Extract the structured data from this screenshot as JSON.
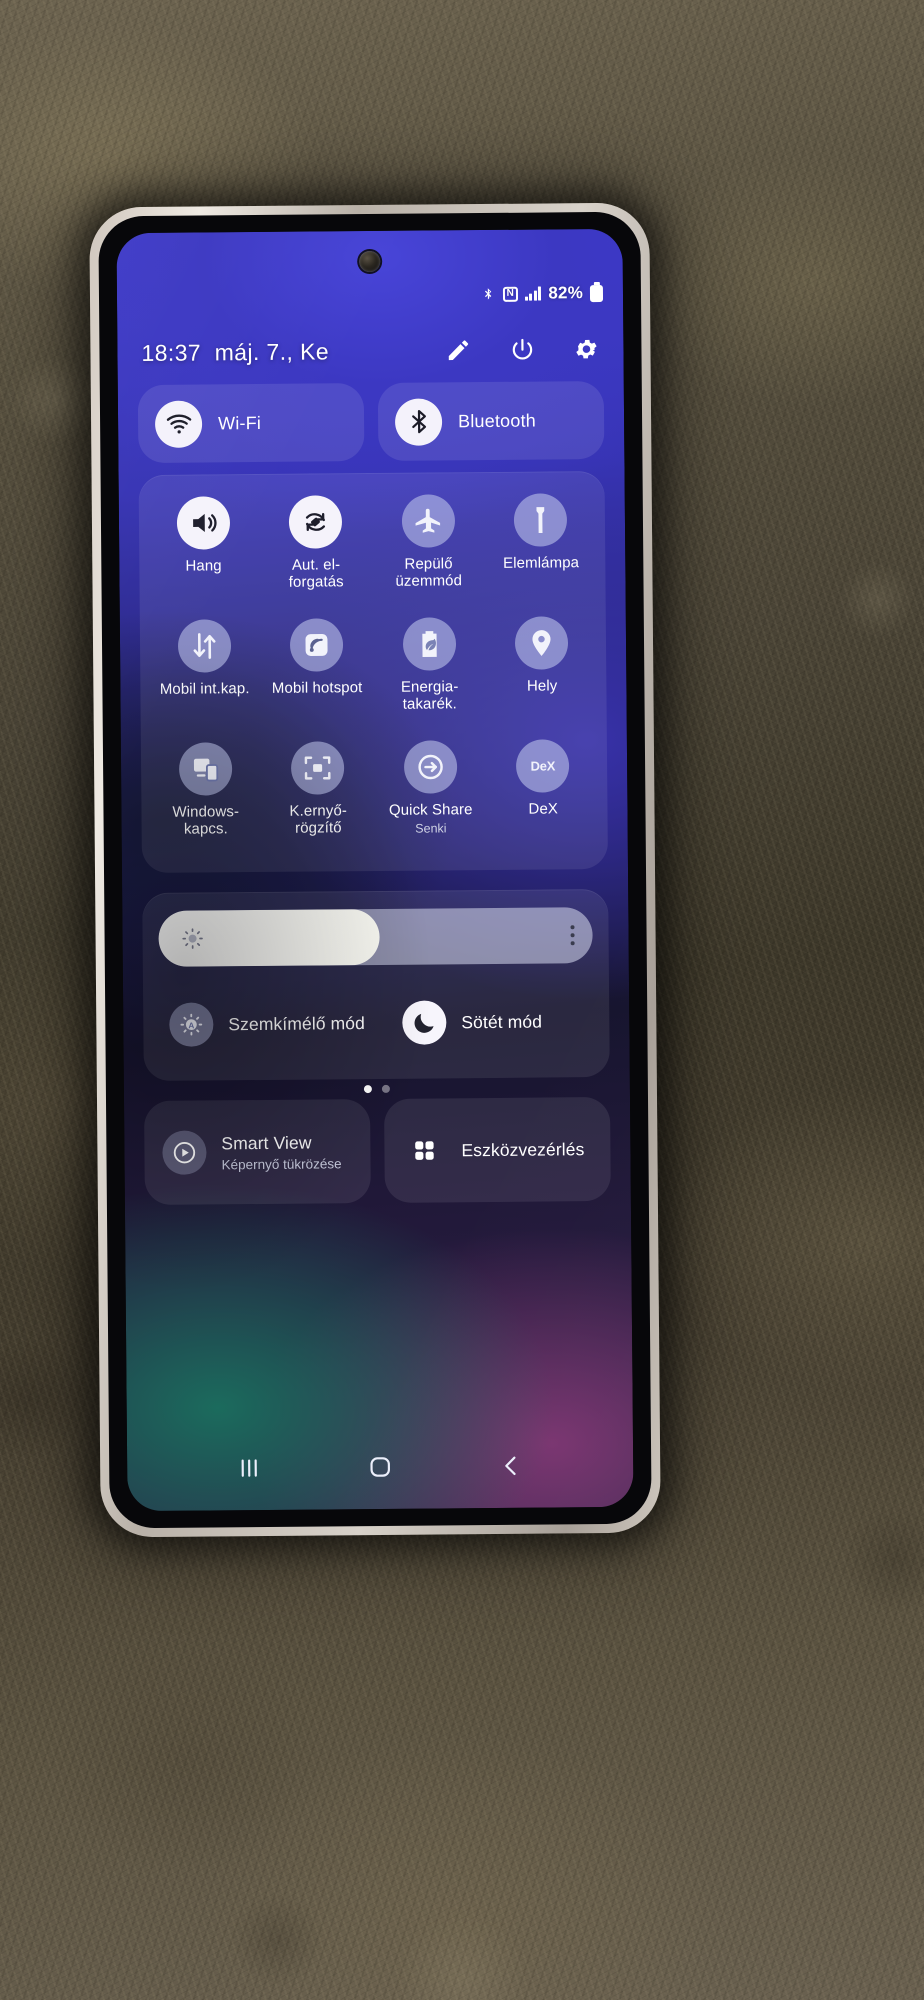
{
  "statusbar": {
    "bluetooth_icon": "bluetooth-icon",
    "nfc_icon": "nfc-icon",
    "nfc_glyph": "N",
    "signal_icon": "signal-bars-icon",
    "battery_percent": "82%",
    "battery_icon": "battery-icon"
  },
  "header": {
    "time": "18:37",
    "date": "máj. 7., Ke",
    "actions": [
      {
        "name": "edit-pencil-icon",
        "label": "Szerkesztés"
      },
      {
        "name": "power-icon",
        "label": "Be-/kikapcsolás"
      },
      {
        "name": "settings-gear-icon",
        "label": "Beállítások"
      }
    ]
  },
  "pills": [
    {
      "icon": "wifi-icon",
      "label": "Wi-Fi",
      "state": "on"
    },
    {
      "icon": "bluetooth-icon",
      "label": "Bluetooth",
      "state": "on"
    }
  ],
  "tiles": [
    {
      "icon": "sound-icon",
      "label": "Hang",
      "sub": "",
      "state": "on"
    },
    {
      "icon": "auto-rotate-icon",
      "label": "Aut. el-forgatás",
      "sub": "",
      "state": "on"
    },
    {
      "icon": "airplane-icon",
      "label": "Repülő üzemmód",
      "sub": "",
      "state": "off"
    },
    {
      "icon": "flashlight-icon",
      "label": "Elemlámpa",
      "sub": "",
      "state": "off"
    },
    {
      "icon": "mobile-data-icon",
      "label": "Mobil int.kap.",
      "sub": "",
      "state": "off"
    },
    {
      "icon": "hotspot-icon",
      "label": "Mobil hotspot",
      "sub": "",
      "state": "off"
    },
    {
      "icon": "power-saving-icon",
      "label": "Energia-takarék.",
      "sub": "",
      "state": "off"
    },
    {
      "icon": "location-pin-icon",
      "label": "Hely",
      "sub": "",
      "state": "off"
    },
    {
      "icon": "windows-link-icon",
      "label": "Windows-kapcs.",
      "sub": "",
      "state": "off"
    },
    {
      "icon": "screen-record-icon",
      "label": "K.ernyő-rögzítő",
      "sub": "",
      "state": "off"
    },
    {
      "icon": "quick-share-icon",
      "label": "Quick Share",
      "sub": "Senki",
      "state": "off"
    },
    {
      "icon": "dex-icon",
      "label": "DeX",
      "sub": "",
      "state": "off"
    }
  ],
  "pager": {
    "total": 2,
    "current": 1
  },
  "brightness": {
    "icon": "brightness-sun-icon",
    "value_percent": 51,
    "more_icon": "more-options-icon"
  },
  "modes": [
    {
      "icon": "eye-comfort-icon",
      "label": "Szemkímélő mód",
      "state": "off"
    },
    {
      "icon": "dark-mode-moon-icon",
      "label": "Sötét mód",
      "state": "on"
    }
  ],
  "bottom_panels": [
    {
      "icon": "smart-view-icon",
      "title": "Smart View",
      "subtitle": "Képernyő tükrözése"
    },
    {
      "icon": "device-control-icon",
      "title": "Eszközvezérlés",
      "subtitle": ""
    }
  ],
  "navbar": [
    {
      "icon": "recents-icon",
      "label": "Legutóbbiak"
    },
    {
      "icon": "home-icon",
      "label": "Kezdőlap"
    },
    {
      "icon": "back-icon",
      "label": "Vissza"
    }
  ],
  "colors": {
    "accent_blue": "#3f3bd0",
    "tile_on": "#f5f3fb",
    "tile_off": "rgba(192,198,236,.58)",
    "text": "#ffffff"
  }
}
